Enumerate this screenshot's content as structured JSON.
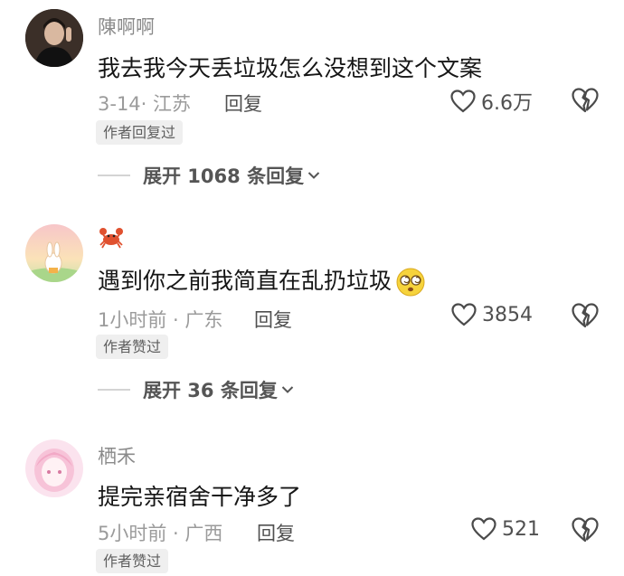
{
  "comments": [
    {
      "username": "陳啊啊",
      "text": "我去我今天丢垃圾怎么没想到这个文案",
      "meta": "3-14· 江苏",
      "reply_label": "回复",
      "likes": "6.6万",
      "badge": "作者回复过",
      "expand": "展开 1068 条回复"
    },
    {
      "username": "",
      "text": "遇到你之前我简直在乱扔垃圾",
      "meta": "1小时前 · 广东",
      "reply_label": "回复",
      "likes": "3854",
      "badge": "作者赞过",
      "expand": "展开 36 条回复"
    },
    {
      "username": "栖禾",
      "text": "提完亲宿舍干净多了",
      "meta": "5小时前 · 广西",
      "reply_label": "回复",
      "likes": "521",
      "badge": "作者赞过"
    }
  ],
  "icons": {
    "like": "heart-outline-icon",
    "dislike": "broken-heart-icon",
    "expand": "chevron-down-icon",
    "crab_username": "crab-emoji-icon",
    "inline_emoji": "dizzy-face-emoji-icon"
  },
  "colors": {
    "text": "#161616",
    "muted": "#9b9b9b",
    "username": "#8a8a8a",
    "badge_bg": "#efefef"
  }
}
